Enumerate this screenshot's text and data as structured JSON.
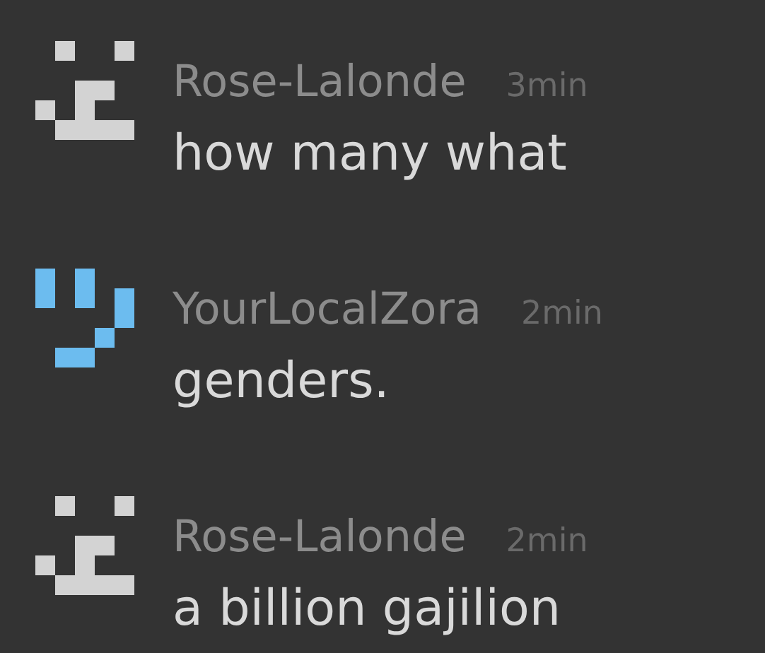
{
  "messages": [
    {
      "author": "Rose-Lalonde",
      "time": "3min",
      "text": "how many what",
      "avatar": {
        "kind": "smirk",
        "color": "#d3d3d3"
      }
    },
    {
      "author": "YourLocalZora",
      "time": "2min",
      "text": "genders.",
      "avatar": {
        "kind": "smile",
        "color": "#6cbcef"
      }
    },
    {
      "author": "Rose-Lalonde",
      "time": "2min",
      "text": "a billion gajilion",
      "avatar": {
        "kind": "smirk",
        "color": "#d3d3d3"
      }
    }
  ]
}
